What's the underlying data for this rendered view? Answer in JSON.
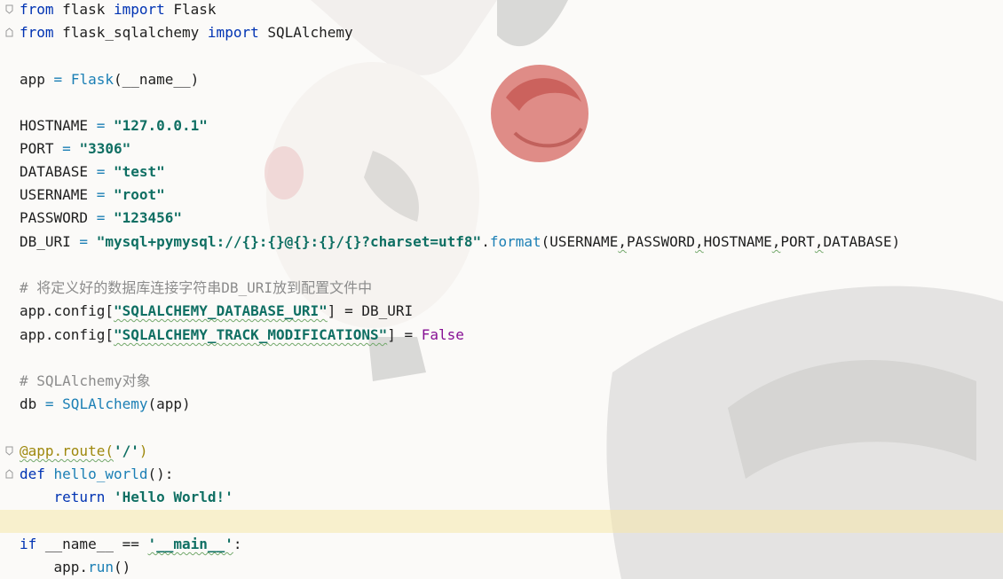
{
  "editor": {
    "lines": [
      {
        "t1": "from",
        "t2": " flask ",
        "t3": "import",
        "t4": " Flask"
      },
      {
        "t1": "from",
        "t2": " flask_sqlalchemy ",
        "t3": "import",
        "t4": " SQLAlchemy"
      },
      {},
      {
        "a": "app",
        "b": " = ",
        "c": "Flask",
        "d": "(__name__)"
      },
      {},
      {
        "a": "HOSTNAME",
        "b": " = ",
        "c": "\"127.0.0.1\""
      },
      {
        "a": "PORT",
        "b": " = ",
        "c": "\"3306\""
      },
      {
        "a": "DATABASE",
        "b": " = ",
        "c": "\"test\""
      },
      {
        "a": "USERNAME",
        "b": " = ",
        "c": "\"root\""
      },
      {
        "a": "PASSWORD",
        "b": " = ",
        "c": "\"123456\""
      },
      {
        "a": "DB_URI",
        "b": " = ",
        "c": "\"mysql+pymysql://{}:{}@{}:{}/{}?charset=utf8\"",
        "d": ".",
        "e": "format",
        "f": "(USERNAME",
        "g": ",",
        "h": "PASSWORD",
        "i": ",",
        "j": "HOSTNAME",
        "k": ",",
        "l": "PORT",
        "m": ",",
        "n": "DATABASE)"
      },
      {},
      {
        "c": "# 将定义好的数据库连接字符串DB_URI放到配置文件中"
      },
      {
        "a": "app.config[",
        "s": "\"SQLALCHEMY_DATABASE_URI\"",
        "b": "] = DB_URI"
      },
      {
        "a": "app.config[",
        "s": "\"SQLALCHEMY_TRACK_MODIFICATIONS\"",
        "b": "] = ",
        "k": "False"
      },
      {},
      {
        "c": "# SQLAlchemy对象"
      },
      {
        "a": "db",
        "b": " = ",
        "c": "SQLAlchemy",
        "d": "(app)"
      },
      {},
      {
        "d1": "@app.route(",
        "s": "'/'",
        "d2": ")"
      },
      {
        "k": "def",
        "f": " hello_world",
        "p": "():"
      },
      {
        "k": "    return",
        "s": " 'Hello World!'"
      },
      {},
      {
        "k": "if",
        "a": " __name__ == ",
        "s": "'__main__'",
        "p": ":"
      },
      {
        "a": "    app.",
        "f": "run",
        "p": "()"
      }
    ]
  },
  "colors": {
    "keyword": "#0033b3",
    "string": "#0f6f63",
    "comment": "#8c8c8c",
    "caret_line": "#f5e8aa"
  }
}
